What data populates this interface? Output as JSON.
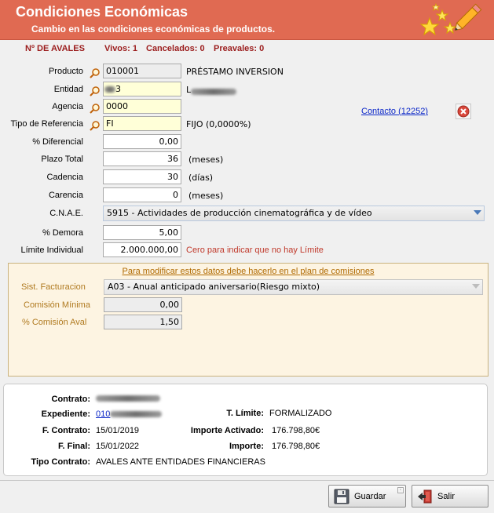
{
  "header": {
    "title": "Condiciones Económicas",
    "subtitle": "Cambio en las condiciones económicas de productos."
  },
  "counts": {
    "avales": "Nº DE AVALES",
    "vivos": "Vivos: 1",
    "cancelados": "Cancelados: 0",
    "preavales": "Preavales: 0"
  },
  "form": {
    "producto": {
      "label": "Producto",
      "value": "010001",
      "desc": "PRÉSTAMO INVERSION"
    },
    "entidad": {
      "label": "Entidad",
      "value": "3",
      "desc": "L"
    },
    "agencia": {
      "label": "Agencia",
      "value": "0000"
    },
    "tipo_referencia": {
      "label": "Tipo de Referencia",
      "value": "FI",
      "desc": "FIJO (0,0000%)"
    },
    "diferencial": {
      "label": "% Diferencial",
      "value": "0,00"
    },
    "plazo": {
      "label": "Plazo Total",
      "value": "36",
      "unit": "(meses)"
    },
    "cadencia": {
      "label": "Cadencia",
      "value": "30",
      "unit": "(días)"
    },
    "carencia": {
      "label": "Carencia",
      "value": "0",
      "unit": "(meses)"
    },
    "cnae": {
      "label": "C.N.A.E.",
      "value": "5915 - Actividades de producción cinematográfica y de vídeo"
    },
    "demora": {
      "label": "% Demora",
      "value": "5,00"
    },
    "limite": {
      "label": "Límite Individual",
      "value": "2.000.000,00",
      "hint": "Cero para indicar que no hay Límite"
    },
    "contacto": "Contacto (12252)"
  },
  "comisiones": {
    "note": "Para modificar estos datos debe hacerlo en el plan de comisiones",
    "sist_label": "Sist. Facturacion",
    "sist_value": "A03 - Anual anticipado aniversario(Riesgo mixto)",
    "minima_label": "Comisión Mínima",
    "minima_value": "0,00",
    "aval_label": "% Comisión Aval",
    "aval_value": "1,50"
  },
  "info": {
    "contrato_label": "Contrato:",
    "expediente_label": "Expediente:",
    "expediente_value": "010",
    "f_contrato_label": "F. Contrato:",
    "f_contrato_value": "15/01/2019",
    "f_final_label": "F. Final:",
    "f_final_value": "15/01/2022",
    "tipo_label": "Tipo Contrato:",
    "tipo_value": "AVALES ANTE ENTIDADES FINANCIERAS",
    "t_limite_label": "T. Límite:",
    "t_limite_value": "FORMALIZADO",
    "importe_activado_label": "Importe Activado:",
    "importe_activado_value": "176.798,80€",
    "importe_label": "Importe:",
    "importe_value": "176.798,80€"
  },
  "buttons": {
    "guardar": "Guardar",
    "salir": "Salir"
  },
  "colors": {
    "header": "#e06a52",
    "panel": "#fdf4e2",
    "counts": "#9b1c1c",
    "hint": "#c0392b"
  },
  "icons": [
    "stars-pencil-icon",
    "magnifier-icon",
    "close-circle-icon",
    "save-disk-icon",
    "exit-door-icon"
  ]
}
